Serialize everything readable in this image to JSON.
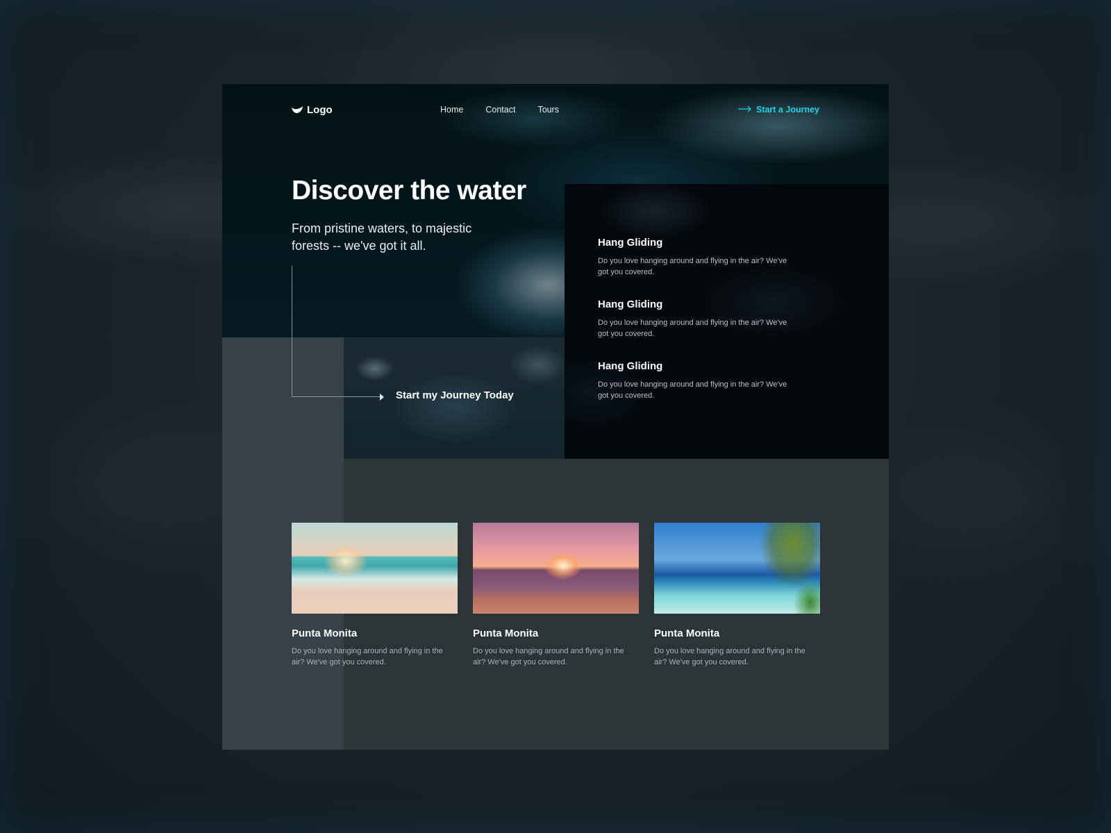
{
  "nav": {
    "logo_text": "Logo",
    "links": [
      {
        "label": "Home"
      },
      {
        "label": "Contact"
      },
      {
        "label": "Tours"
      }
    ],
    "cta_label": "Start a Journey"
  },
  "hero": {
    "title": "Discover the water",
    "subtitle": "From pristine waters, to majestic forests -- we've got it all.",
    "journey_label": "Start my Journey Today"
  },
  "features": [
    {
      "title": "Hang Gliding",
      "description": "Do you love hanging around and flying in the air? We've got you covered."
    },
    {
      "title": "Hang Gliding",
      "description": "Do you love hanging around and flying in the air? We've got you covered."
    },
    {
      "title": "Hang Gliding",
      "description": "Do you love hanging around and flying in the air? We've got you covered."
    }
  ],
  "cards": [
    {
      "title": "Punta Monita",
      "description": "Do you love hanging around and flying in the air? We've got you covered.",
      "image": "beach-sunrise"
    },
    {
      "title": "Punta Monita",
      "description": "Do you love hanging around and flying in the air? We've got you covered.",
      "image": "beach-sunset"
    },
    {
      "title": "Punta Monita",
      "description": "Do you love hanging around and flying in the air? We've got you covered.",
      "image": "palm-beach"
    }
  ],
  "colors": {
    "accent": "#22d3e6",
    "page_bg": "#2d3438",
    "strip_bg": "#374148",
    "outer_bg": "#141c22"
  }
}
